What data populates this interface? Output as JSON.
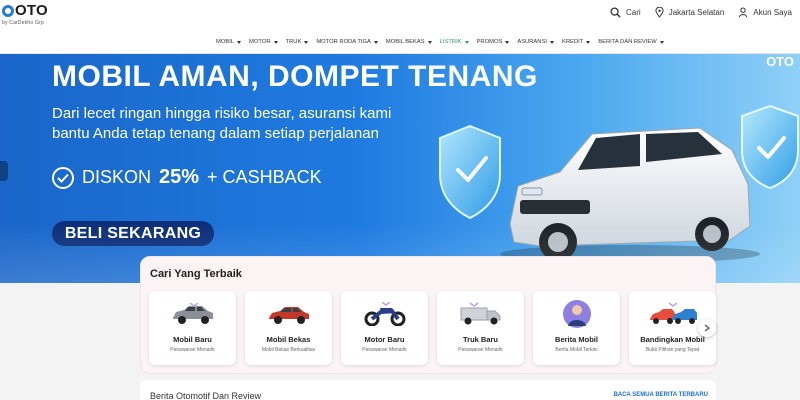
{
  "header": {
    "logo": {
      "main": "OTO",
      "sub": "by CarDekho Grp"
    },
    "actions": [
      {
        "label": "Cari",
        "icon": "search-icon"
      },
      {
        "label": "Jakarta Selatan",
        "icon": "location-pin-icon"
      },
      {
        "label": "Akun Saya",
        "icon": "user-icon"
      }
    ]
  },
  "nav": {
    "items": [
      {
        "label": "MOBIL",
        "active": false
      },
      {
        "label": "MOTOR",
        "active": false
      },
      {
        "label": "TRUK",
        "active": false
      },
      {
        "label": "MOTOR RODA TIGA",
        "active": false
      },
      {
        "label": "MOBIL BEKAS",
        "active": false
      },
      {
        "label": "LISTRIK",
        "active": true
      },
      {
        "label": "PROMOS",
        "active": false
      },
      {
        "label": "ASURANSI",
        "active": false
      },
      {
        "label": "KREDIT",
        "active": false
      },
      {
        "label": "BERITA DAN REVIEW",
        "active": false
      }
    ]
  },
  "banner": {
    "title": "MOBIL AMAN, DOMPET TENANG",
    "subtitle": "Dari lecet ringan hingga risiko besar, asuransi kami bantu Anda tetap tenang dalam setiap perjalanan",
    "discount_prefix": "DISKON",
    "discount_pct": "25%",
    "discount_suffix": "+ CASHBACK",
    "cta": "BELI SEKARANG",
    "corner_logo": "OTO"
  },
  "search": {
    "title": "Cari Yang Terbaik",
    "categories": [
      {
        "name": "Mobil Baru",
        "desc": "Penawaran Menarik",
        "icon": "car-icon",
        "color": "#8a8f98"
      },
      {
        "name": "Mobil Bekas",
        "desc": "Mobil Bekas Berkualitas",
        "icon": "used-car-icon",
        "color": "#c0392b"
      },
      {
        "name": "Motor Baru",
        "desc": "Penawaran Menarik",
        "icon": "motorcycle-icon",
        "color": "#2c3e8f"
      },
      {
        "name": "Truk Baru",
        "desc": "Penawaran Menarik",
        "icon": "truck-icon",
        "color": "#bfc3c8"
      },
      {
        "name": "Berita Mobil",
        "desc": "Berita Mobil Terkini",
        "icon": "news-person-icon",
        "color": "#6a5acd"
      },
      {
        "name": "Bandingkan Mobil",
        "desc": "Bukti Pilihan yang Tepat",
        "icon": "compare-cars-icon",
        "color": "#e74c3c"
      }
    ]
  },
  "news": {
    "title": "Berita Otomotif Dan Review",
    "link": "BACA SEMUA BERITA TERBARU"
  }
}
